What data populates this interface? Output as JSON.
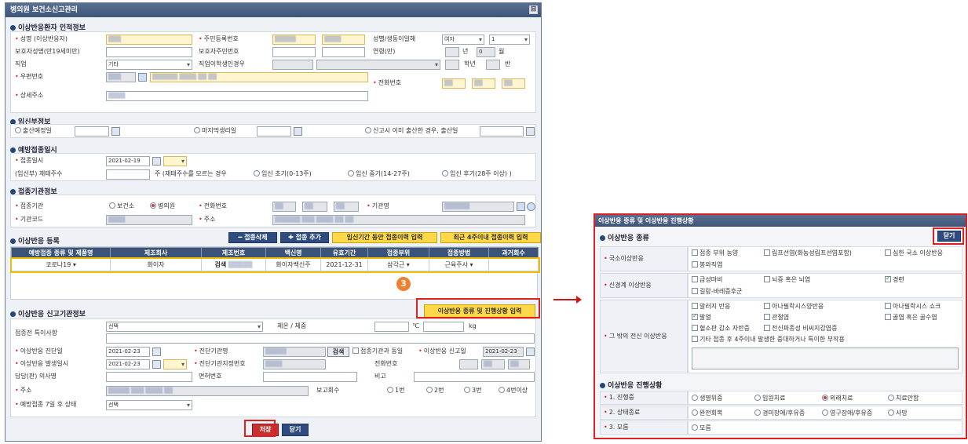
{
  "win": {
    "title": "병의원 보건소신고관리",
    "close": "⊠"
  },
  "s1": {
    "title": "이상반응환자 인적정보",
    "name_lbl": "성명 (이상반응자)",
    "rrn_lbl": "주민등록번호",
    "sex_lbl": "성별/생동이일해",
    "sex_val": "여자",
    "sex_val2": "1",
    "guardian_lbl": "보호자성명(만19세미만)",
    "guardian_rrn_lbl": "보호자주민번호",
    "age_lbl": "연령(만)",
    "age_y": "년",
    "age_m": "월",
    "age_m_val": "0",
    "job_lbl": "직업",
    "job_val": "기타",
    "student_lbl": "직업이학생인경우",
    "grade1": "학년",
    "grade2": "반",
    "zip_lbl": "우편번호",
    "phone_lbl": "전화번호",
    "addr_lbl": "상세주소"
  },
  "s2": {
    "title": "임신부정보",
    "due_lbl": "출산예정일",
    "lmp_lbl": "마지막생리일",
    "birth_lbl": "신고시 이미 출산한 경우, 출산일"
  },
  "s3": {
    "title": "예방접종일시",
    "date_lbl": "접종일시",
    "date_val": "2021-02-19",
    "preg_lbl": "(임신부) 재태주수",
    "week_note": "주 (재태주수를 모르는 경우",
    "r1": "임신 초기(0-13주)",
    "r2": "임신 중기(14-27주)",
    "r3": "임신 후기(28주 이상) )"
  },
  "s4": {
    "title": "접종기관정보",
    "org_lbl": "접종기관",
    "org_r1": "보건소",
    "org_r2": "병의원",
    "tel_lbl": "전화번호",
    "orgname_lbl": "기관명",
    "code_lbl": "기관코드",
    "addr_lbl": "주소"
  },
  "s5": {
    "title": "이상반응 등록",
    "del_btn": "━ 접종삭제",
    "add_btn": "✚ 접종 추가",
    "btn_a": "임신기간 동안 접종이력 입력",
    "btn_b": "최근 4주이내 접종이력 입력",
    "headers": [
      "예방접종 종류 및 제품명",
      "제조회사",
      "제조번호",
      "백신명",
      "유효기간",
      "접종부위",
      "접종방법",
      "과거회수"
    ],
    "row": {
      "kind": "코로나19",
      "maker": "화이자",
      "search": "검색",
      "vaccine": "화이자백신주",
      "expiry": "2021-12-31",
      "site": "삼각근",
      "method": "근육주사"
    }
  },
  "s6": {
    "title": "이상반응 신고기관정보",
    "detail_btn": "이상반응 종류 및 진행상황 입력",
    "special_lbl": "접종전 특이사항",
    "special_val": "선택",
    "temp_lbl": "체온 / 체중",
    "temp_unit": "℃",
    "wt_unit": "kg",
    "diag_lbl": "이상반응 진단일",
    "diag_val": "2021-02-23",
    "diag_org_lbl": "진단기관명",
    "search_btn": "검색",
    "same_lbl": "접종기관과 동일",
    "report_lbl": "이상반응 신고일",
    "report_val": "2021-02-23",
    "occur_lbl": "이상반응 발생일시",
    "occur_val": "2021-02-23",
    "diag_num_lbl": "진단기관지정번호",
    "phone_lbl": "전화번호",
    "doctor_lbl": "담당(판) 의사명",
    "license_lbl": "면허번호",
    "note_lbl": "비고",
    "addr_lbl": "주소",
    "count_lbl": "보고회수",
    "c1": "1번",
    "c2": "2번",
    "c3": "3번",
    "c4": "4번이상",
    "after_lbl": "예방접종 7일 후 상태",
    "after_val": "선택"
  },
  "footer": {
    "save": "저장",
    "close": "닫기"
  },
  "badge": "3",
  "pop": {
    "title": "이상반응 종류 및 이상반응 진행상황",
    "sec1": "이상반응 종류",
    "close": "닫기",
    "g1": "국소이상반응",
    "g1_items": [
      "접종 부위 농양",
      "림프선염(화농성림프선염포함)",
      "심한 국소 이상반응",
      "봉와직염"
    ],
    "g2": "신경계 이상반응",
    "g2_items": [
      "급성마비",
      "뇌증 혹은 뇌염",
      "경련",
      "길랑-바레증후군"
    ],
    "g3": "그 밖의 전신 이상반응",
    "g3_items": [
      "알러지 반응",
      "아나필락시스양반응",
      "아나필락시스 쇼크",
      "발열",
      "관절염",
      "골염 혹은 골수염",
      "혈소판 감소 자반증",
      "전신파종성 비씨지감염증",
      "기타 접종 후 4주이내 발생한 중대하거나 특이한 부작용"
    ],
    "sec2": "이상반응 진행상황",
    "p1": "1. 진행중",
    "p1_items": [
      "생명위중",
      "입원치료",
      "외래치료",
      "치료안함"
    ],
    "p2": "2. 상태종료",
    "p2_items": [
      "완전회복",
      "경미장애/후유증",
      "영구장애/후유증",
      "사망"
    ],
    "p3": "3. 모름",
    "p3_items": [
      "모름"
    ]
  }
}
